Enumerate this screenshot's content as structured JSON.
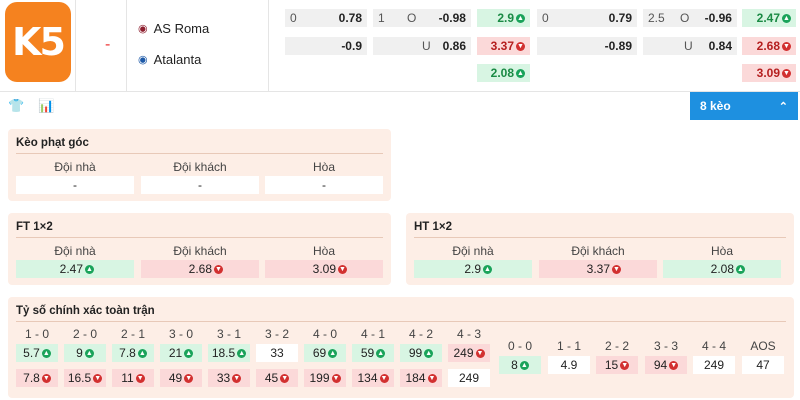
{
  "logo_text": "K5",
  "match": {
    "separator": "-",
    "home": "AS Roma",
    "away": "Atalanta"
  },
  "odds_top": {
    "r1": {
      "a_label": "0",
      "a_val": "0.78",
      "b_label": "1",
      "b_mid": "O",
      "b_val": "-0.98",
      "c_val": "2.9",
      "d_label": "0",
      "d_val": "0.79",
      "e_label": "2.5",
      "e_mid": "O",
      "e_val": "-0.96",
      "f_val": "2.47"
    },
    "r2": {
      "a_val": "-0.9",
      "b_mid": "U",
      "b_val": "0.86",
      "c_val": "3.37",
      "d_val": "-0.89",
      "e_mid": "U",
      "e_val": "0.84",
      "f_val": "2.68"
    },
    "r3": {
      "c_val": "2.08",
      "f_val": "3.09"
    }
  },
  "toolbar": {
    "shirt_icon": "shirt-icon",
    "chart_icon": "chart-icon",
    "keo_label": "8 kèo"
  },
  "corner": {
    "title": "Kèo phạt góc",
    "headers": [
      "Đội nhà",
      "Đội khách",
      "Hòa"
    ],
    "values": [
      "-",
      "-",
      "-"
    ]
  },
  "ft": {
    "title": "FT 1×2",
    "headers": [
      "Đội nhà",
      "Đội khách",
      "Hòa"
    ],
    "values": [
      "2.47",
      "2.68",
      "3.09"
    ]
  },
  "ht": {
    "title": "HT 1×2",
    "headers": [
      "Đội nhà",
      "Đội khách",
      "Hòa"
    ],
    "values": [
      "2.9",
      "3.37",
      "2.08"
    ]
  },
  "cs": {
    "title": "Tỷ số chính xác toàn trận",
    "left_headers": [
      "1 - 0",
      "2 - 0",
      "2 - 1",
      "3 - 0",
      "3 - 1",
      "3 - 2",
      "4 - 0",
      "4 - 1",
      "4 - 2",
      "4 - 3"
    ],
    "left_row1": [
      "5.7",
      "9",
      "7.8",
      "21",
      "18.5",
      "33",
      "69",
      "59",
      "99",
      "249"
    ],
    "left_row2": [
      "7.8",
      "16.5",
      "11",
      "49",
      "33",
      "45",
      "199",
      "134",
      "184",
      "249"
    ],
    "right_headers": [
      "0 - 0",
      "1 - 1",
      "2 - 2",
      "3 - 3",
      "4 - 4",
      "AOS"
    ],
    "right_vals": [
      "8",
      "4.9",
      "15",
      "94",
      "249",
      "47"
    ]
  },
  "colors": {
    "up": "#d8f5e3",
    "down": "#fbd9d9",
    "accent": "#1e90e0",
    "panel": "#fdeee6",
    "logo": "#f5821f"
  }
}
